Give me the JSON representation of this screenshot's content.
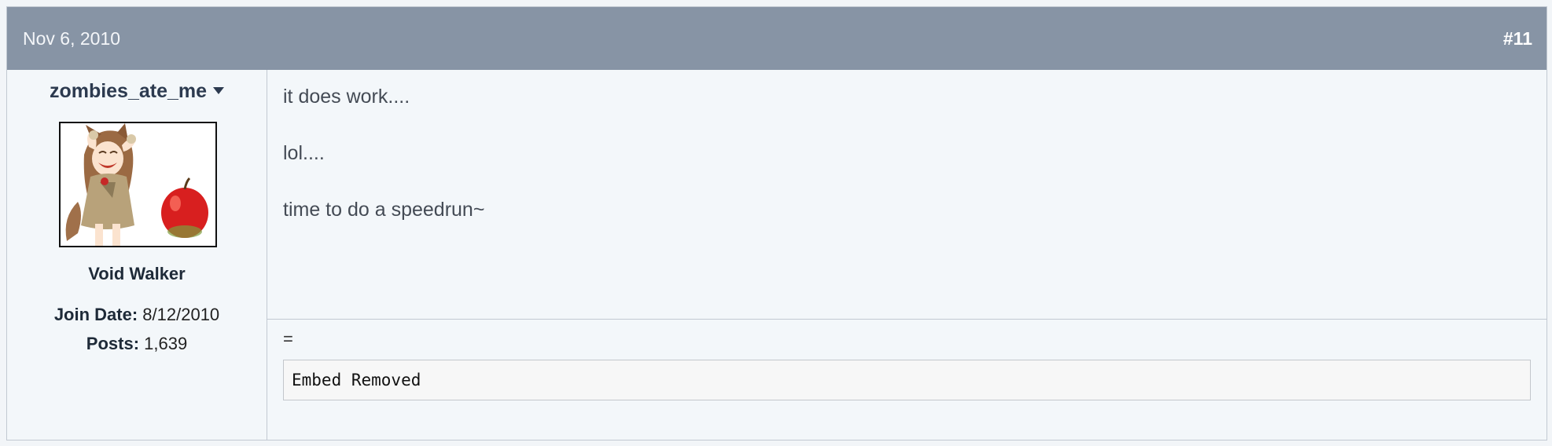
{
  "post": {
    "date": "Nov 6, 2010",
    "number": "#11"
  },
  "user": {
    "name": "zombies_ate_me",
    "title": "Void Walker",
    "join_date_label": "Join Date:",
    "join_date_value": "8/12/2010",
    "posts_label": "Posts:",
    "posts_value": "1,639"
  },
  "message": {
    "lines": [
      "it does work....",
      "lol....",
      "time to do a speedrun~"
    ]
  },
  "signature": {
    "symbol": "=",
    "embed_text": "Embed Removed"
  },
  "colors": {
    "header_bg": "#8794a5",
    "body_bg": "#f3f7fa",
    "border": "#c2c9d2"
  },
  "icons": {
    "username_menu": "caret-down-icon"
  }
}
